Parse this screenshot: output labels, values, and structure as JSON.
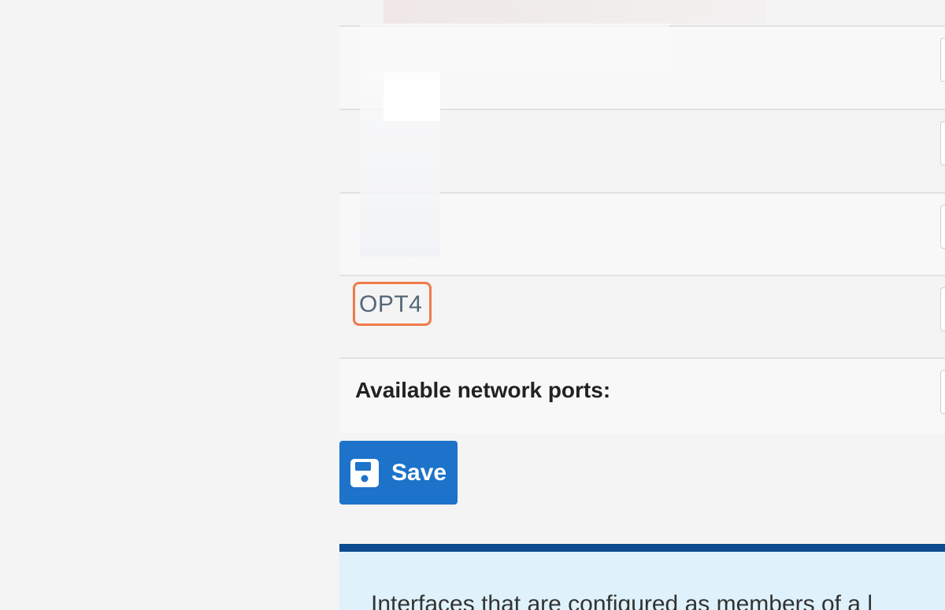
{
  "rows": {
    "opt_label": "OPT4"
  },
  "ports": {
    "label": "Available network ports:"
  },
  "actions": {
    "save_label": "Save"
  },
  "info": {
    "text": "Interfaces that are configured as members of a l"
  },
  "colors": {
    "primary": "#1c73c9",
    "highlight": "#f07b4a",
    "info_border": "#0d4a8f",
    "info_bg": "#dff2fb"
  }
}
